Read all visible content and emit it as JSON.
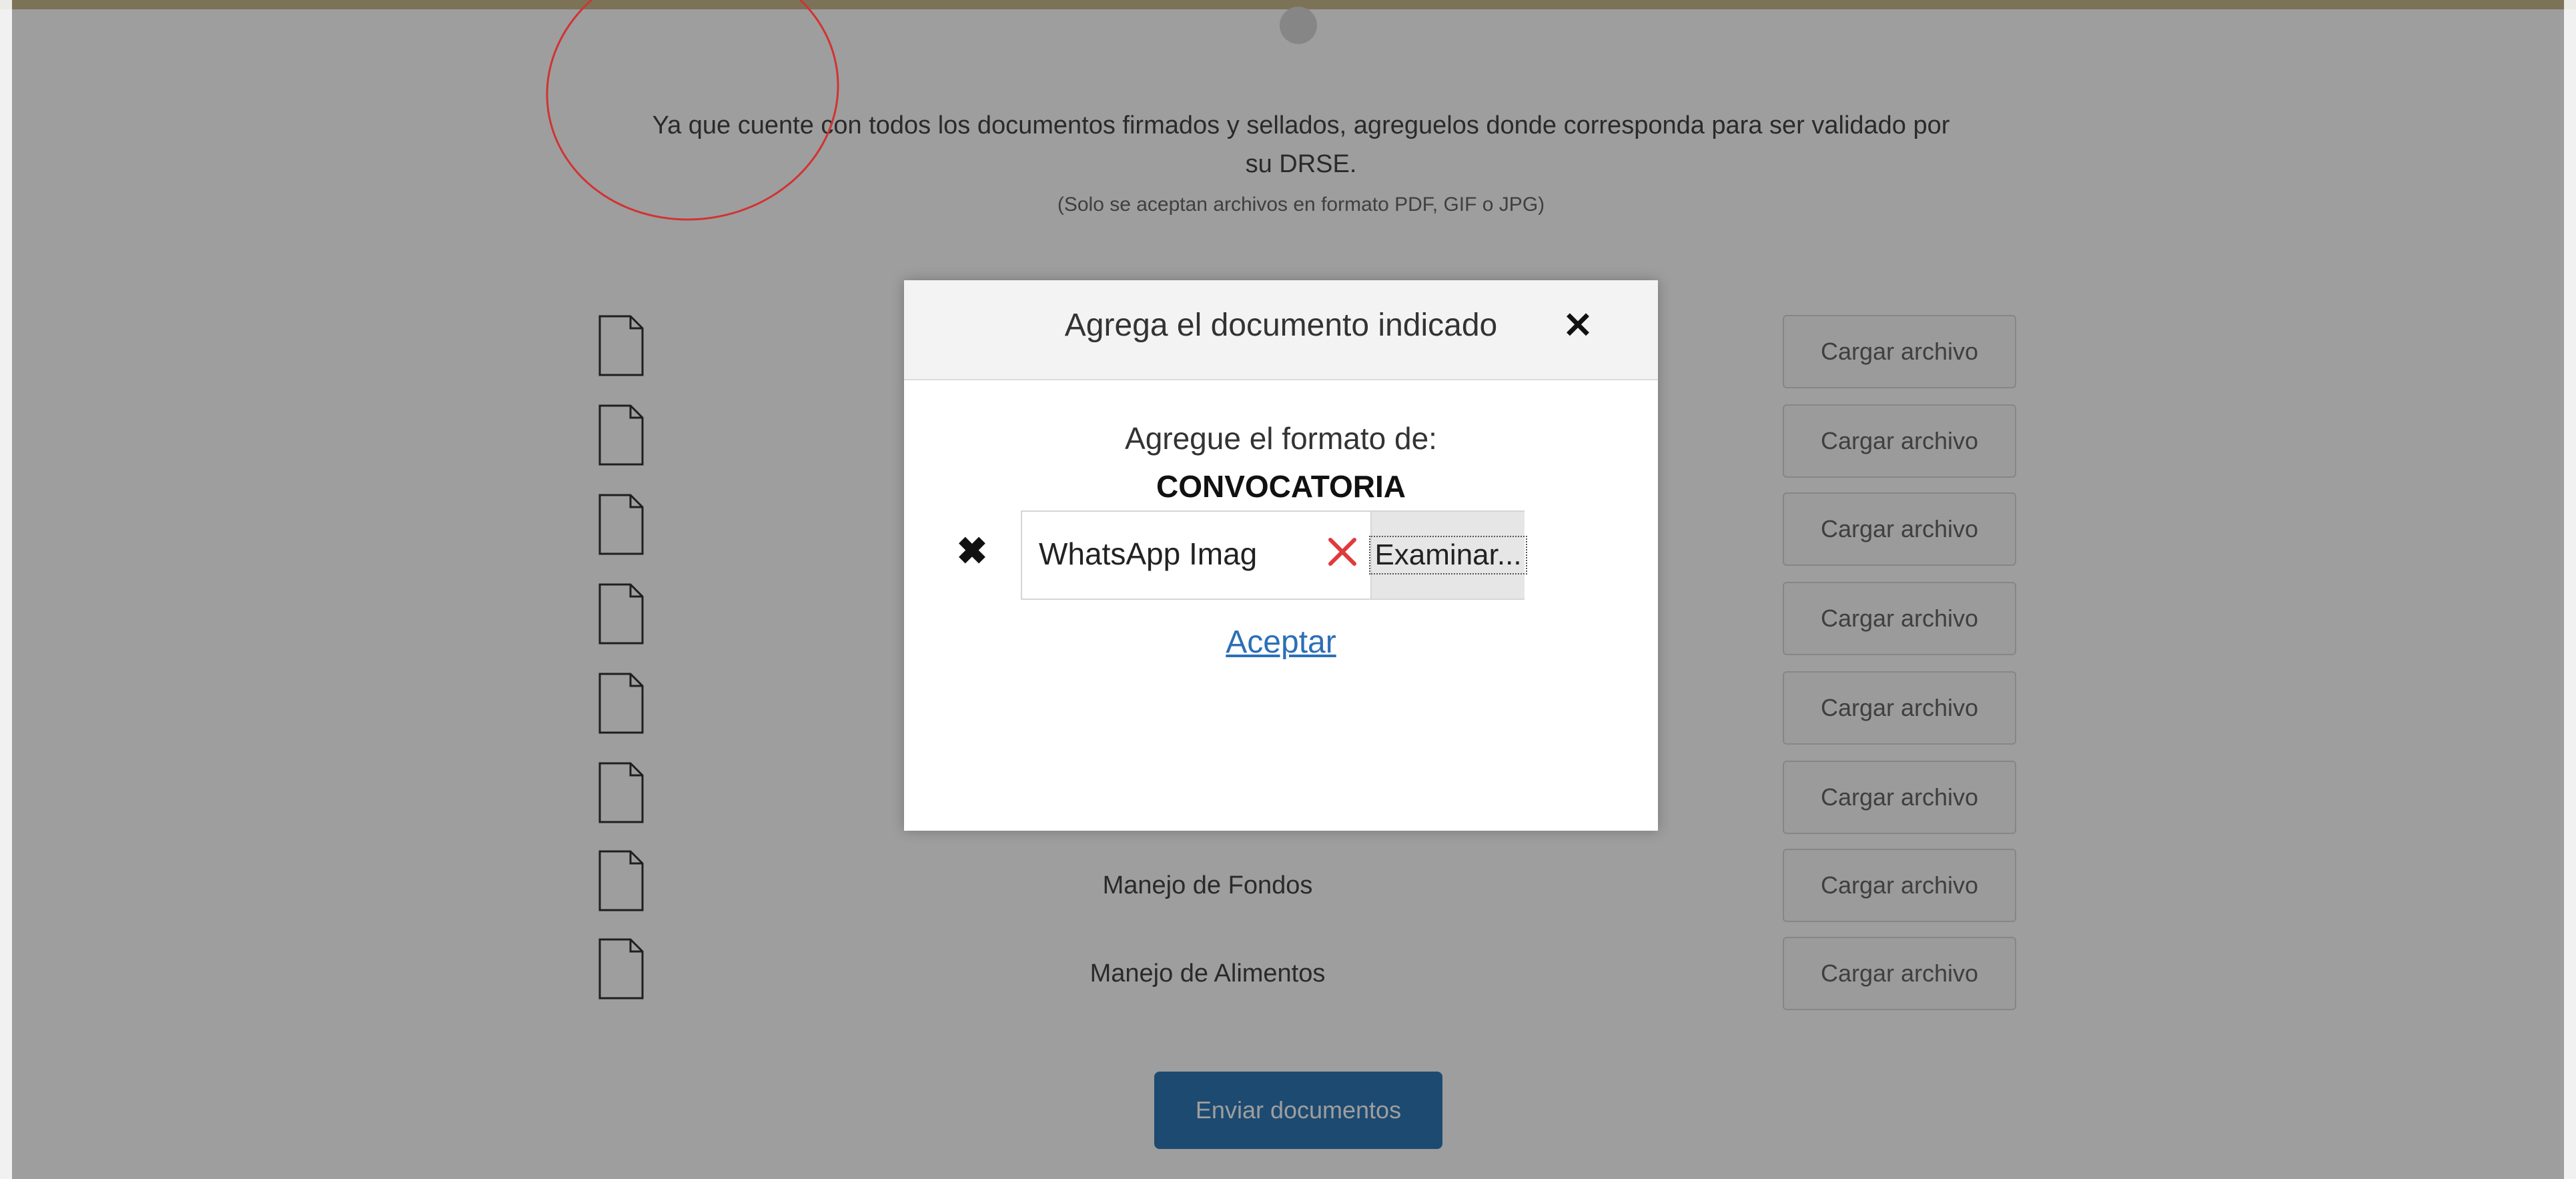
{
  "intro": {
    "line1": "Ya que cuente con todos los documentos firmados y sellados, agreguelos donde corresponda para ser validado por",
    "line2": "su DRSE.",
    "note": "(Solo se aceptan archivos en formato PDF, GIF o JPG)"
  },
  "documents": [
    {
      "label": "",
      "button": "Cargar archivo"
    },
    {
      "label": "",
      "button": "Cargar archivo"
    },
    {
      "label": "",
      "button": "Cargar archivo"
    },
    {
      "label": "",
      "button": "Cargar archivo"
    },
    {
      "label": "",
      "button": "Cargar archivo"
    },
    {
      "label": "",
      "button": "Cargar archivo"
    },
    {
      "label": "Manejo de Fondos",
      "button": "Cargar archivo"
    },
    {
      "label": "Manejo de Alimentos",
      "button": "Cargar archivo"
    }
  ],
  "send_button": "Enviar documentos",
  "modal": {
    "title": "Agrega el documento indicado",
    "subtitle": "Agregue el formato de:",
    "format": "CONVOCATORIA",
    "file_name": "WhatsApp Imag",
    "browse_label": "Examinar...",
    "accept_label": "Aceptar"
  },
  "colors": {
    "overlay": "#000000",
    "accent": "#2f78b7",
    "annotation": "#d13333",
    "clear_icon": "#e03a3a"
  },
  "icons": [
    "document-icon",
    "close-icon",
    "remove-icon",
    "clear-icon"
  ]
}
